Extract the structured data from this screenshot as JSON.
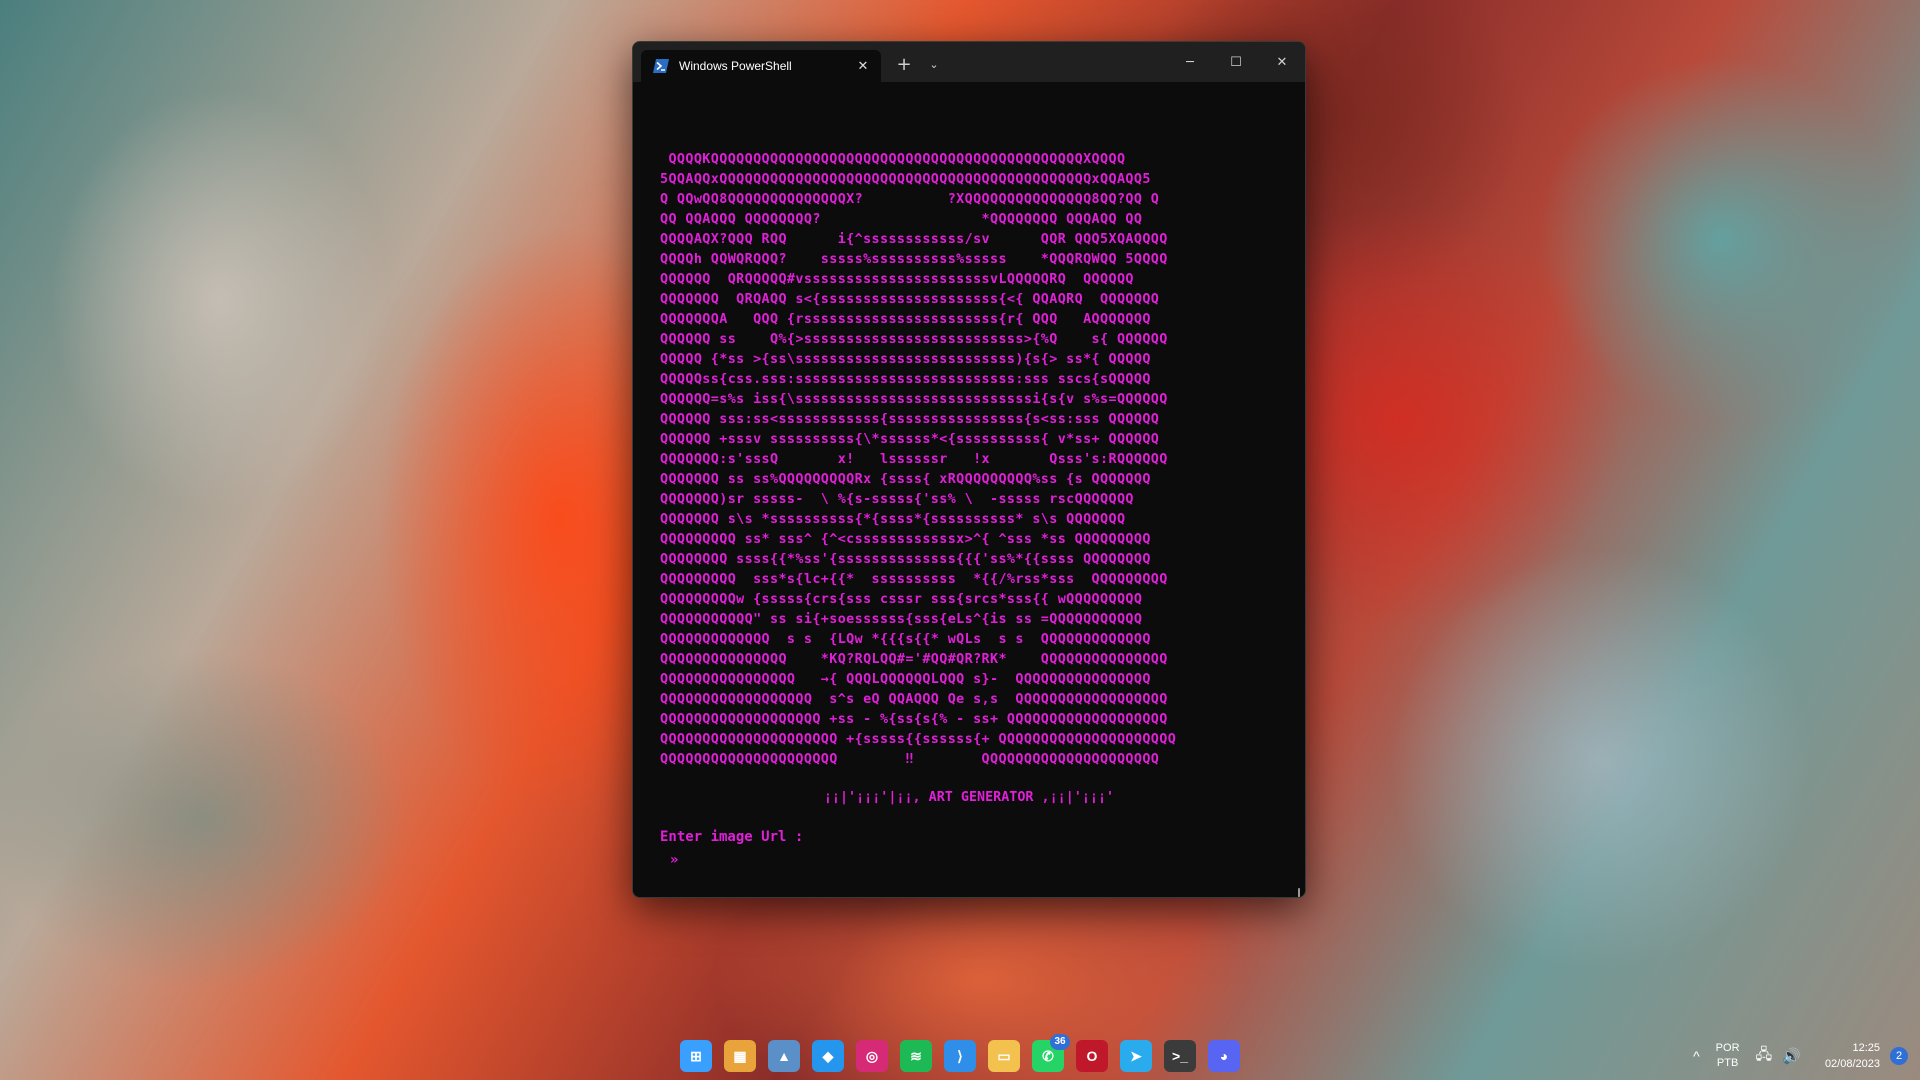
{
  "window": {
    "tab_title": "Windows PowerShell",
    "tab_close": "✕",
    "new_tab": "+",
    "dropdown": "⌄",
    "minimize": "─",
    "maximize": "☐",
    "close": "✕"
  },
  "terminal": {
    "text_color": "#e020d8",
    "ascii_art": " QQQQKQQQQQQQQQQQQQQQQQQQQQQQQQQQQQQQQQQQQQQQQQQQQXQQQQ\n5QQAQQxQQQQQQQQQQQQQQQQQQQQQQQQQQQQQQQQQQQQQQQQQQQQxQQAQQ5\nQ QQwQQ8QQQQQQQQQQQQQQX?          ?XQQQQQQQQQQQQQQQ8QQ?QQ Q\nQQ QQAQQQ QQQQQQQQ?                   *QQQQQQQQ QQQAQQ QQ\nQQQQAQX?QQQ RQQ      i{^ssssssssssss/sv      QQR QQQ5XQAQQQQ\nQQQQh QQWQRQQQ?    sssss%ssssssssss%sssss    *QQQRQWQQ 5QQQQ\nQQQQQQ  QRQQQQQ#vssssssssssssssssssssssvLQQQQQRQ  QQQQQQ\nQQQQQQQ  QRQAQQ s<{sssssssssssssssssssss{<{ QQAQRQ  QQQQQQQ\nQQQQQQQA   QQQ {rsssssssssssssssssssssss{r{ QQQ   AQQQQQQQ\nQQQQQQ ss    Q%{>ssssssssssssssssssssssssss>{%Q    s{ QQQQQQ\nQQQQQ {*ss >{ss\\ssssssssssssssssssssssssss){s{> ss*{ QQQQQ\nQQQQQss{css.sss:ssssssssssssssssssssssssss:sss sscs{sQQQQQ\nQQQQQQ=s%s iss{\\ssssssssssssssssssssssssssssi{s{v s%s=QQQQQQ\nQQQQQQ sss:ss<ssssssssssss{ssssssssssssssss{s<ss:sss QQQQQQ\nQQQQQQ +sssv ssssssssss{\\*ssssss*<{ssssssssss{ v*ss+ QQQQQQ\nQQQQQQQ:s'sssQ       x!   lssssssr   !x       Qsss's:RQQQQQQ\nQQQQQQQ ss ss%QQQQQQQQQRx {ssss{ xRQQQQQQQQQ%ss {s QQQQQQQ\nQQQQQQQ)sr sssss-  \\ %{s-sssss{'ss% \\  -sssss rscQQQQQQQ\nQQQQQQQ s\\s *ssssssssss{*{ssss*{ssssssssss* s\\s QQQQQQQ\nQQQQQQQQQ ss* sss^ {^<cssssssssssssx>^{ ^sss *ss QQQQQQQQQ\nQQQQQQQQ ssss{{*%ss'{ssssssssssssss{{{'ss%*{{ssss QQQQQQQQ\nQQQQQQQQQ  sss*s{lc+{{*  ssssssssss  *{{/%rss*sss  QQQQQQQQQ\nQQQQQQQQQw {sssss{crs{sss csssr sss{srcs*sss{{ wQQQQQQQQQ\nQQQQQQQQQQQ\" ss si{+soessssss{sss{eLs^{is ss =QQQQQQQQQQQ\nQQQQQQQQQQQQQ  s s  {LQw *{{{s{{* wQLs  s s  QQQQQQQQQQQQQ\nQQQQQQQQQQQQQQQ    *KQ?RQLQQ#='#QQ#QR?RK*    QQQQQQQQQQQQQQQ\nQQQQQQQQQQQQQQQQ   →{ QQQLQQQQQQLQQQ s}-  QQQQQQQQQQQQQQQQ\nQQQQQQQQQQQQQQQQQQ  s^s eQ QQAQQQ Qe s,s  QQQQQQQQQQQQQQQQQQ\nQQQQQQQQQQQQQQQQQQQ +ss - %{ss{s{% - ss+ QQQQQQQQQQQQQQQQQQQ\nQQQQQQQQQQQQQQQQQQQQQ +{sssss{{ssssss{+ QQQQQQQQQQQQQQQQQQQQQ\nQQQQQQQQQQQQQQQQQQQQQ        ‼        QQQQQQQQQQQQQQQQQQQQQ",
    "banner": "¡¡|'¡¡¡'|¡¡, ART GENERATOR ,¡¡|'¡¡¡'",
    "prompt": "Enter image Url :",
    "cursor": "»"
  },
  "taskbar": {
    "apps": [
      {
        "name": "windows-start-icon",
        "glyph": "⊞",
        "color": "#3aa0ff"
      },
      {
        "name": "widgets-icon",
        "glyph": "▦",
        "color": "#e8a33a"
      },
      {
        "name": "photos-icon",
        "glyph": "▲",
        "color": "#5a8fc8"
      },
      {
        "name": "docker-icon",
        "glyph": "◆",
        "color": "#2496ed"
      },
      {
        "name": "instagram-icon",
        "glyph": "◎",
        "color": "#d62976"
      },
      {
        "name": "spotify-icon",
        "glyph": "≋",
        "color": "#1db954"
      },
      {
        "name": "vscode-icon",
        "glyph": "⟩",
        "color": "#2f8ee8"
      },
      {
        "name": "file-explorer-icon",
        "glyph": "▭",
        "color": "#f2c14e"
      },
      {
        "name": "whatsapp-icon",
        "glyph": "✆",
        "color": "#25d366",
        "badge": "36"
      },
      {
        "name": "opera-icon",
        "glyph": "O",
        "color": "#c0182b"
      },
      {
        "name": "telegram-icon",
        "glyph": "➤",
        "color": "#2aabee"
      },
      {
        "name": "terminal-icon",
        "glyph": ">_",
        "color": "#3b3b3b"
      },
      {
        "name": "discord-icon",
        "glyph": "◕",
        "color": "#5865f2"
      }
    ],
    "tray": {
      "chevron": "^",
      "lang_top": "POR",
      "lang_bottom": "PTB",
      "network": "🖧",
      "volume": "🔊",
      "time": "12:25",
      "date": "02/08/2023",
      "notifications": "2"
    }
  }
}
